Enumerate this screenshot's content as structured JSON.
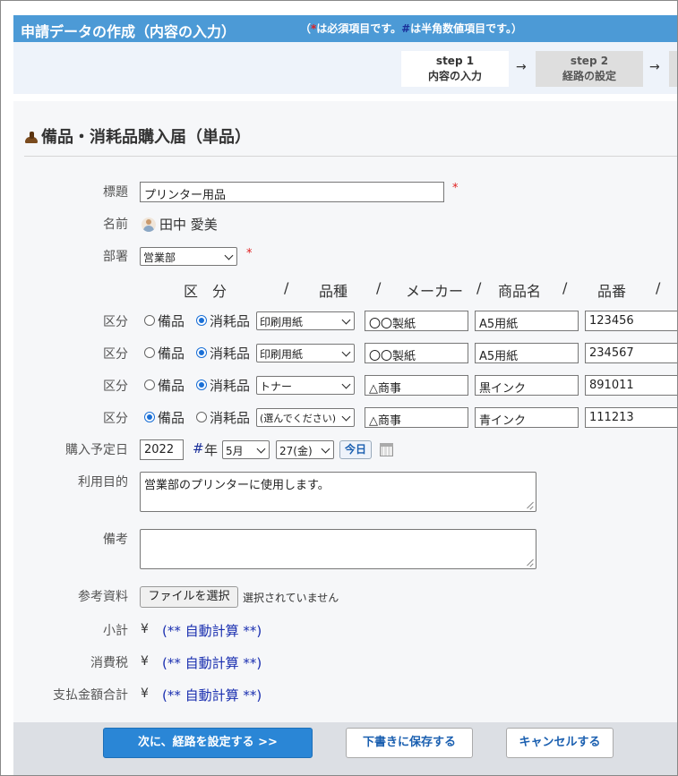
{
  "header": {
    "title": "申請データの作成（内容の入力）",
    "note_open": "（",
    "note_star": "*",
    "note_mid": "は必須項目です。",
    "note_hash": "#",
    "note_end": "は半角数値項目です。）"
  },
  "steps": [
    {
      "num": "step 1",
      "label": "内容の入力"
    },
    {
      "num": "step 2",
      "label": "経路の設定"
    }
  ],
  "arrow": "→",
  "form": {
    "title": "備品・消耗品購入届（単品）",
    "subject": {
      "label": "標題",
      "value": "プリンター用品"
    },
    "name": {
      "label": "名前",
      "value": "田中 愛美"
    },
    "dept": {
      "label": "部署",
      "value": "営業部"
    },
    "required_mark": "*",
    "columns": [
      "区　分",
      "/",
      "品種",
      "/",
      "メーカー",
      "/",
      "商品名",
      "/",
      "品番",
      "/"
    ],
    "item_label": "区分",
    "radio_labels": [
      "備品",
      "消耗品"
    ],
    "items": [
      {
        "selected": 1,
        "kind": "印刷用紙",
        "maker": "〇〇製紙",
        "product": "A5用紙",
        "number": "123456"
      },
      {
        "selected": 1,
        "kind": "印刷用紙",
        "maker": "〇〇製紙",
        "product": "A5用紙",
        "number": "234567"
      },
      {
        "selected": 1,
        "kind": "トナー",
        "maker": "△商事",
        "product": "黒インク",
        "number": "891011"
      },
      {
        "selected": 0,
        "kind": "(選んでください)",
        "maker": "△商事",
        "product": "青インク",
        "number": "111213"
      }
    ],
    "purchase_date": {
      "label": "購入予定日",
      "year": "2022",
      "hash": "#",
      "year_suffix": "年",
      "month": "5月",
      "day": "27(金)",
      "today_label": "今日"
    },
    "purpose": {
      "label": "利用目的",
      "value": "営業部のプリンターに使用します。"
    },
    "remarks": {
      "label": "備考",
      "value": ""
    },
    "attachment": {
      "label": "参考資料",
      "button": "ファイルを選択",
      "status": "選択されていません"
    },
    "subtotal": {
      "label": "小計",
      "yen": "¥",
      "value": "(** 自動計算 **)"
    },
    "tax": {
      "label": "消費税",
      "yen": "¥",
      "value": "(** 自動計算 **)"
    },
    "total": {
      "label": "支払金額合計",
      "yen": "¥",
      "value": "(** 自動計算 **)"
    }
  },
  "footer": {
    "next": "次に、経路を設定する >>",
    "draft": "下書きに保存する",
    "cancel": "キャンセルする"
  }
}
